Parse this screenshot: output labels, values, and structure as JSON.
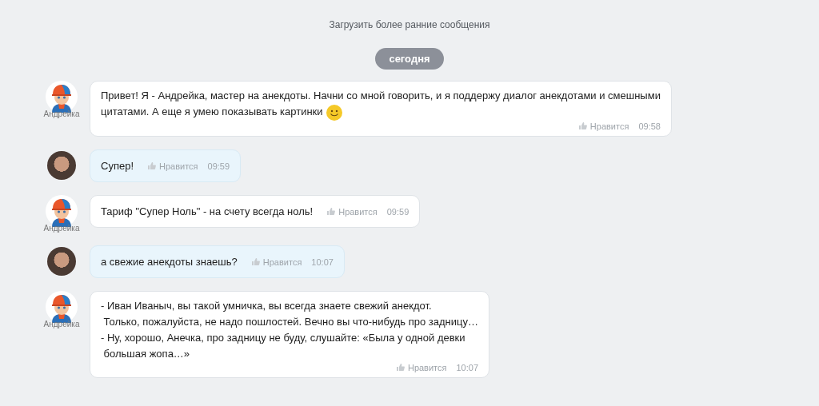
{
  "load_earlier": "Загрузить более ранние сообщения",
  "date_badge": "сегодня",
  "messages": [
    {
      "kind": "bot",
      "author": "Андрейка",
      "lines": [
        "Привет! Я - Андрейка, мастер на анекдоты. Начни со мной говорить, и я поддержу диалог анекдотами и смешными",
        "цитатами. А еще я умею показывать картинки"
      ],
      "emoji": true,
      "like": "Нравится",
      "time": "09:58"
    },
    {
      "kind": "user",
      "lines": [
        "Супер!"
      ],
      "emoji": false,
      "like": "Нравится",
      "time": "09:59"
    },
    {
      "kind": "bot",
      "author": "Андрейка",
      "lines": [
        "Тариф \"Супер Ноль\" - на счету всегда ноль!"
      ],
      "emoji": false,
      "like": "Нравится",
      "time": "09:59"
    },
    {
      "kind": "user",
      "lines": [
        "а свежие анекдоты знаешь?"
      ],
      "emoji": false,
      "like": "Нравится",
      "time": "10:07"
    },
    {
      "kind": "bot",
      "author": "Андрейка",
      "lines": [
        "- Иван Иваныч, вы такой умничка, вы всегда знаете свежий анекдот.",
        " Только, пожалуйста, не надо пошлостей. Вечно вы что-нибудь про задницу…",
        "- Ну, хорошо, Анечка, про задницу не буду, слушайте: «Была у одной девки",
        " большая жопа…»"
      ],
      "emoji": false,
      "like": "Нравится",
      "time": "10:07"
    }
  ]
}
